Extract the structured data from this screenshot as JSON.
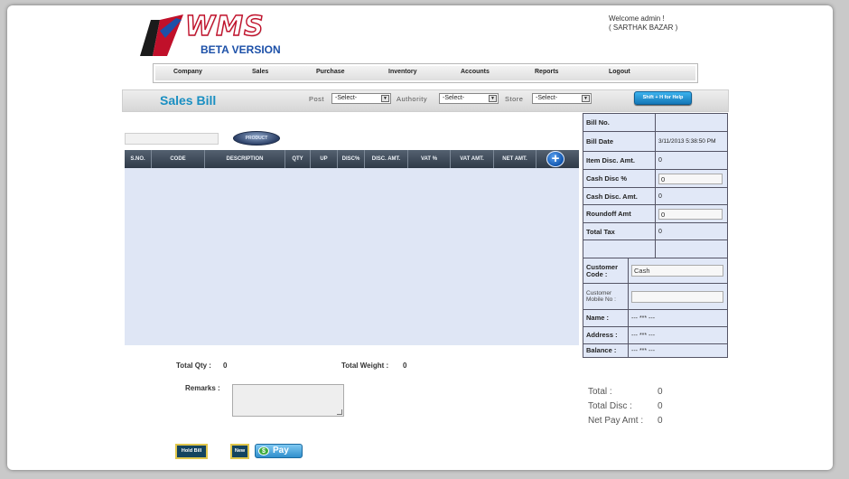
{
  "header": {
    "logo_text": "WMS",
    "logo_subtitle": "BETA VERSION",
    "welcome": "Welcome admin !",
    "store_name": "( SARTHAK BAZAR )"
  },
  "menu": [
    "Company",
    "Sales",
    "Purchase",
    "Inventory",
    "Accounts",
    "Reports",
    "Logout"
  ],
  "titlebar": {
    "title": "Sales Bill",
    "post_label": "Post",
    "post_value": "-Select-",
    "authority_label": "Authority",
    "authority_value": "-Select-",
    "store_label": "Store",
    "store_value": "-Select-",
    "help_label": "Shift + H for Help"
  },
  "search": {
    "button_label": "PRODUCT"
  },
  "grid": {
    "columns": [
      "S.NO.",
      "CODE",
      "DESCRIPTION",
      "QTY",
      "UP",
      "DISC%",
      "DISC. AMT.",
      "VAT %",
      "VAT AMT.",
      "NET AMT."
    ],
    "add_icon_glyph": "+"
  },
  "bill_panel": {
    "bill_no_label": "Bill No.",
    "bill_no": "",
    "bill_date_label": "Bill Date",
    "bill_date": "3/11/2013 5:38:50 PM",
    "item_disc_label": "Item Disc. Amt.",
    "item_disc": "0",
    "cash_disc_pct_label": "Cash Disc %",
    "cash_disc_pct": "0",
    "cash_disc_amt_label": "Cash Disc. Amt.",
    "cash_disc_amt": "0",
    "roundoff_label": "Roundoff Amt",
    "roundoff": "0",
    "total_tax_label": "Total Tax",
    "total_tax": "0"
  },
  "customer_panel": {
    "code_label": "Customer Code :",
    "code": "Cash",
    "mobile_label": "Customer Mobile No :",
    "mobile": "",
    "name_label": "Name :",
    "name": "--- *** ---",
    "address_label": "Address :",
    "address": "--- *** ---",
    "balance_label": "Balance :",
    "balance": "--- *** ---"
  },
  "footer": {
    "total_qty_label": "Total Qty :",
    "total_qty": "0",
    "total_weight_label": "Total Weight :",
    "total_weight": "0",
    "remarks_label": "Remarks :",
    "total_label": "Total :",
    "total": "0",
    "total_disc_label": "Total Disc :",
    "total_disc": "0",
    "net_pay_label": "Net Pay Amt :",
    "net_pay": "0"
  },
  "buttons": {
    "hold_bill": "Hold Bill",
    "new": "New",
    "pay": "Pay",
    "pay_icon_glyph": "$"
  },
  "colors": {
    "accent": "#1a8fc2",
    "grid_header": "#3b4757",
    "panel_bg": "#e1e8f7",
    "logo_red": "#c0102a"
  }
}
